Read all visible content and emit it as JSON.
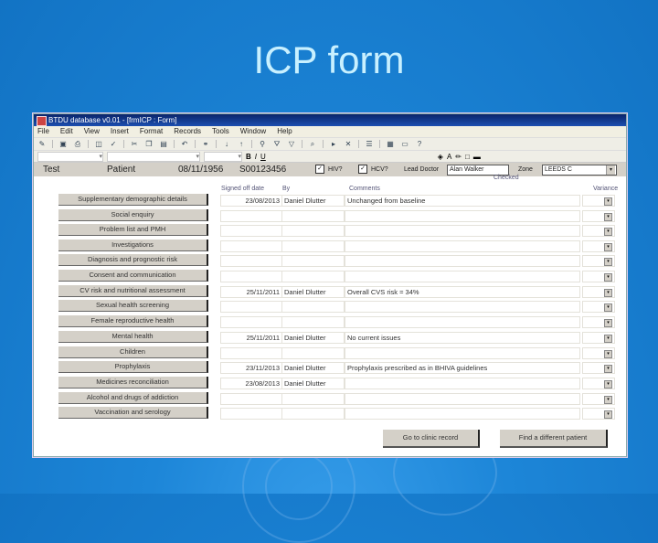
{
  "slide": {
    "title": "ICP form"
  },
  "window": {
    "title": "BTDU database v0.01 - [frmICP : Form]",
    "menu": [
      "File",
      "Edit",
      "View",
      "Insert",
      "Format",
      "Records",
      "Tools",
      "Window",
      "Help"
    ]
  },
  "patient": {
    "first_name": "Test",
    "last_name": "Patient",
    "dob": "08/11/1956",
    "id": "S00123456",
    "check1_label": "HIV?",
    "check1_checked": true,
    "check2_label": "HCV?",
    "check2_checked": true,
    "lead_doctor_label": "Lead Doctor",
    "lead_doctor_value": "Alan Walker",
    "zone_label": "Zone",
    "zone_value": "LEEDS C"
  },
  "form": {
    "checked_label": "Checked",
    "col_signed_off": "Signed off date",
    "col_by": "By",
    "col_comments": "Comments",
    "col_variance": "Variance",
    "rows": [
      {
        "label": "Supplementary demographic details",
        "date": "23/08/2013",
        "by": "Daniel Dlutter",
        "comment": "Unchanged from baseline"
      },
      {
        "label": "Social enquiry",
        "date": "",
        "by": "",
        "comment": ""
      },
      {
        "label": "Problem list and PMH",
        "date": "",
        "by": "",
        "comment": ""
      },
      {
        "label": "Investigations",
        "date": "",
        "by": "",
        "comment": ""
      },
      {
        "label": "Diagnosis and prognostic risk",
        "date": "",
        "by": "",
        "comment": ""
      },
      {
        "label": "Consent and communication",
        "date": "",
        "by": "",
        "comment": ""
      },
      {
        "label": "CV risk and nutritional assessment",
        "date": "25/11/2011",
        "by": "Daniel Dlutter",
        "comment": "Overall CVS risk = 34%"
      },
      {
        "label": "Sexual health screening",
        "date": "",
        "by": "",
        "comment": ""
      },
      {
        "label": "Female reproductive health",
        "date": "",
        "by": "",
        "comment": ""
      },
      {
        "label": "Mental health",
        "date": "25/11/2011",
        "by": "Daniel Dlutter",
        "comment": "No current issues"
      },
      {
        "label": "Children",
        "date": "",
        "by": "",
        "comment": ""
      },
      {
        "label": "Prophylaxis",
        "date": "23/11/2013",
        "by": "Daniel Dlutter",
        "comment": "Prophylaxis prescribed as in BHIVA guidelines"
      },
      {
        "label": "Medicines reconciliation",
        "date": "23/08/2013",
        "by": "Daniel Dlutter",
        "comment": ""
      },
      {
        "label": "Alcohol and drugs of addiction",
        "date": "",
        "by": "",
        "comment": ""
      },
      {
        "label": "Vaccination and serology",
        "date": "",
        "by": "",
        "comment": ""
      }
    ],
    "go_clinic_label": "Go to clinic record",
    "find_patient_label": "Find a different patient"
  }
}
